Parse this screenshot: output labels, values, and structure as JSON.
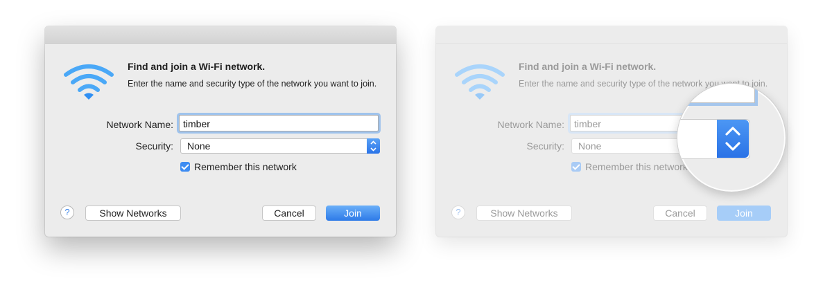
{
  "dialogs": [
    {
      "heading": "Find and join a Wi-Fi network.",
      "description": "Enter the name and security type of the network you want to join.",
      "network_name_label": "Network Name:",
      "network_name_value": "timber",
      "security_label": "Security:",
      "security_value": "None",
      "remember_label": "Remember this network",
      "remember_checked": true,
      "help_glyph": "?",
      "show_networks_label": "Show Networks",
      "cancel_label": "Cancel",
      "join_label": "Join"
    },
    {
      "heading": "Find and join a Wi-Fi network.",
      "description": "Enter the name and security type of the network you want to join.",
      "network_name_label": "Network Name:",
      "network_name_value": "timber",
      "security_label": "Security:",
      "security_value": "None",
      "remember_label": "Remember this network",
      "remember_checked": true,
      "help_glyph": "?",
      "show_networks_label": "Show Networks",
      "cancel_label": "Cancel",
      "join_label": "Join"
    }
  ],
  "icons": {
    "wifi": "wifi-icon",
    "stepper": "up-down-chevron-icon",
    "help": "question-mark-icon",
    "check": "checkmark-icon"
  },
  "colors": {
    "accent": "#2d7ae8",
    "wifi_blue": "#3b9df5",
    "dialog_bg": "#ececec"
  }
}
